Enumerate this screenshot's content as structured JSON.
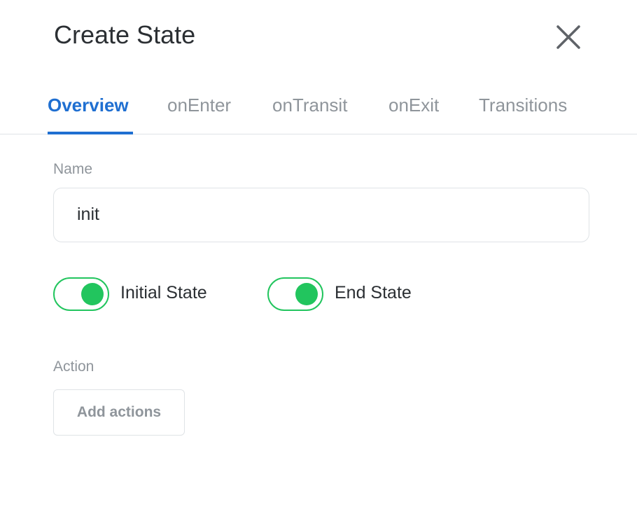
{
  "dialog": {
    "title": "Create State",
    "close_icon": "close-icon"
  },
  "tabs": [
    {
      "label": "Overview",
      "active": true
    },
    {
      "label": "onEnter",
      "active": false
    },
    {
      "label": "onTransit",
      "active": false
    },
    {
      "label": "onExit",
      "active": false
    },
    {
      "label": "Transitions",
      "active": false
    }
  ],
  "form": {
    "name_label": "Name",
    "name_value": "init",
    "initial_state": {
      "label": "Initial State",
      "checked": true
    },
    "end_state": {
      "label": "End State",
      "checked": true
    },
    "action_label": "Action",
    "add_actions_label": "Add actions"
  },
  "colors": {
    "accent": "#1f6fd1",
    "toggle_on": "#22c55e",
    "muted_text": "#8f959b",
    "text": "#2b2f33",
    "border": "#dfe3e6"
  }
}
